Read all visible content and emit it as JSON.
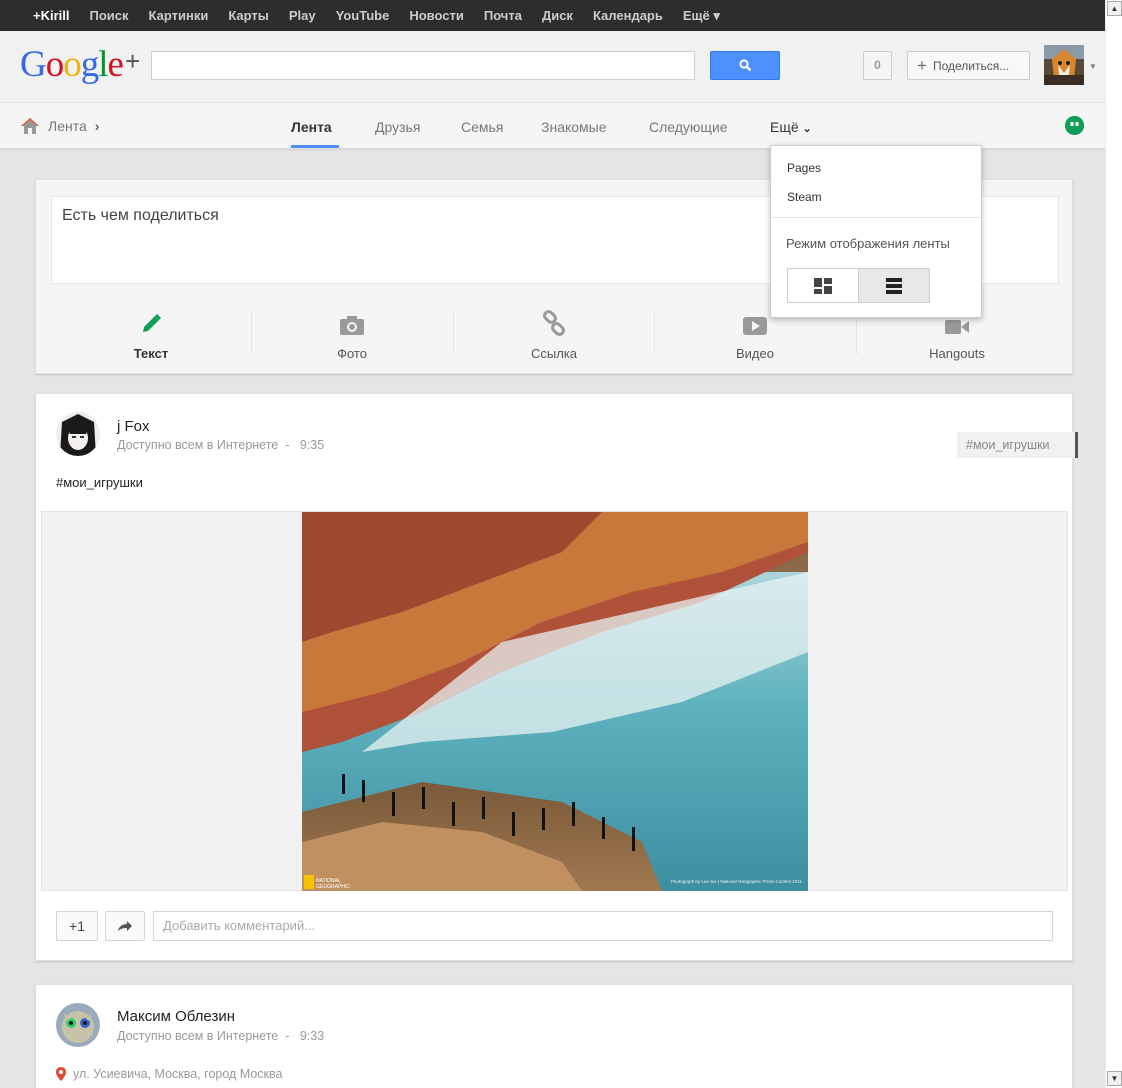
{
  "topbar": {
    "items": [
      "+Kirill",
      "Поиск",
      "Картинки",
      "Карты",
      "Play",
      "YouTube",
      "Новости",
      "Почта",
      "Диск",
      "Календарь",
      "Ещё ▾"
    ]
  },
  "header": {
    "logo_letters": [
      "G",
      "o",
      "o",
      "g",
      "l",
      "e"
    ],
    "logo_plus": "+",
    "search_placeholder": "",
    "notifications_count": "0",
    "share_button_label": "Поделиться..."
  },
  "subnav": {
    "breadcrumb": "Лента",
    "tabs": [
      "Лента",
      "Друзья",
      "Семья",
      "Знакомые",
      "Следующие",
      "Ещё"
    ]
  },
  "dropdown": {
    "items": [
      "Pages",
      "Steam"
    ],
    "view_mode_label": "Режим отображения ленты"
  },
  "share_card": {
    "prompt": "Есть чем поделиться",
    "types": [
      "Текст",
      "Фото",
      "Ссылка",
      "Видео",
      "Hangouts"
    ]
  },
  "posts": [
    {
      "author": "j Fox",
      "visibility": "Доступно всем в Интернете",
      "time": "9:35",
      "hashtag": "#мои_игрушки",
      "text": "#мои_игрушки",
      "image_credit_logo": "NATIONAL GEOGRAPHIC",
      "image_credit": "Photograph by Lee Sie | National Geographic Photo Contest 2011",
      "plus_one": "+1",
      "comment_placeholder": "Добавить комментарий..."
    },
    {
      "author": "Максим Облезин",
      "visibility": "Доступно всем в Интернете",
      "time": "9:33",
      "location": "ул. Усиевича, Москва, город Москва"
    }
  ],
  "colors": {
    "topbar": "#2d2d2d",
    "accent_blue": "#4d90fe",
    "hangouts_green": "#0f9d58",
    "share_text_green": "#0f9d58"
  },
  "icons": [
    "home-icon",
    "search-icon",
    "plus-icon",
    "hangouts-icon",
    "pencil-icon",
    "camera-icon",
    "link-icon",
    "video-icon",
    "hangouts-video-icon",
    "grid-view-icon",
    "list-view-icon",
    "reshare-icon",
    "location-pin-icon"
  ]
}
